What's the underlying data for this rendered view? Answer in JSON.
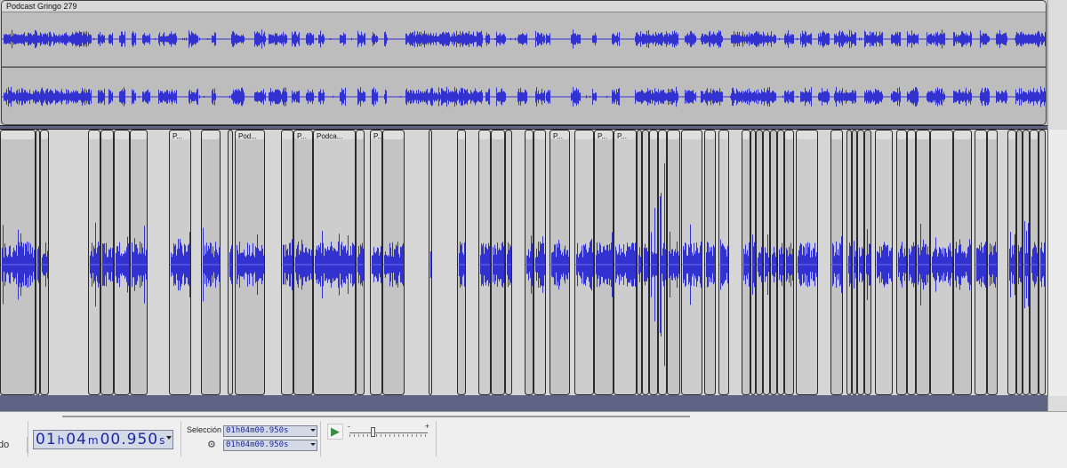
{
  "track1": {
    "clip_name": "Podcast Gringo 279"
  },
  "track2": {
    "clip_labels": [
      "P...",
      "Pod...",
      "P...",
      "Podca...",
      "P...",
      "P...",
      "P...",
      "P..."
    ]
  },
  "toolbar": {
    "left_partial_label": "do",
    "audio_position": {
      "hours": "01",
      "h_unit": "h",
      "minutes": "04",
      "m_unit": "m",
      "seconds": "00.950",
      "s_unit": "s"
    },
    "selection_label": "Selección",
    "selection_start": "01h04m00.950s",
    "selection_end": "01h04m00.950s",
    "speed_slider": {
      "minus": "-",
      "plus": "+",
      "level": 0.3
    }
  },
  "colors": {
    "waveform": "#3232d0",
    "waveform_light": "#6e6ee6",
    "background": "#5e6584",
    "time_text": "#1c28a0",
    "play_green": "#3c8c46"
  }
}
